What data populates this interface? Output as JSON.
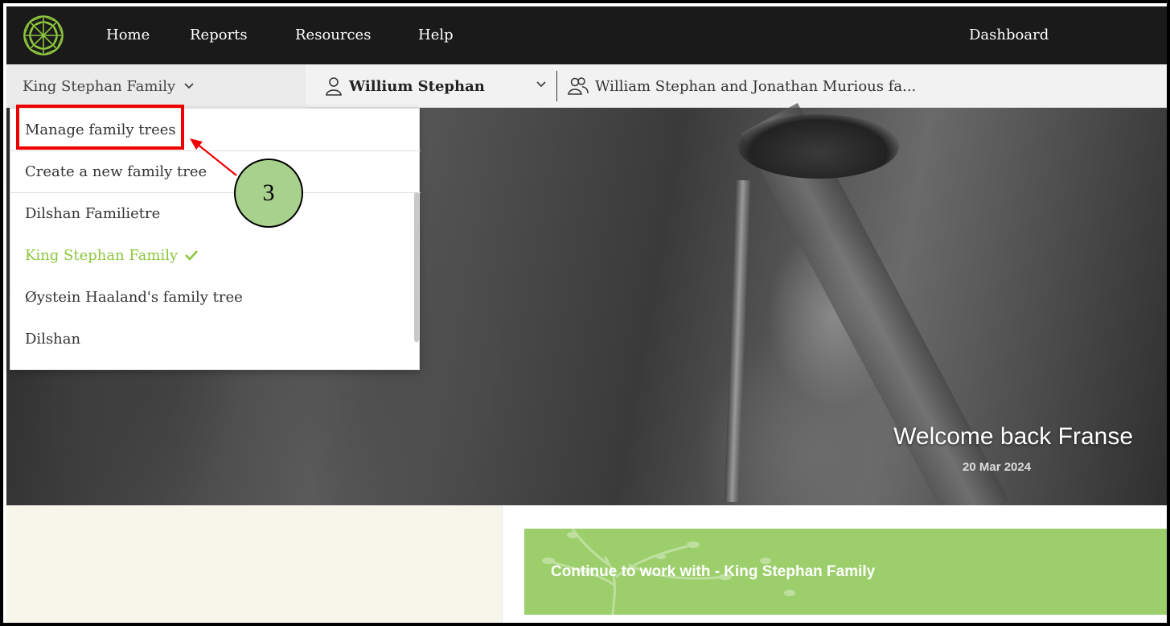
{
  "nav": {
    "home": "Home",
    "reports": "Reports",
    "resources": "Resources",
    "help": "Help",
    "dashboard": "Dashboard"
  },
  "subbar": {
    "tree_selected": "King Stephan Family",
    "person_name": "Willium Stephan",
    "family_name": "William Stephan and Jonathan Murious fa..."
  },
  "dropdown": {
    "actions": [
      "Manage family trees",
      "Create a new family tree"
    ],
    "trees": [
      {
        "label": "Dilshan Familietre",
        "active": false
      },
      {
        "label": "King Stephan Family",
        "active": true
      },
      {
        "label": "Øystein Haaland's family tree",
        "active": false
      },
      {
        "label": "Dilshan",
        "active": false
      }
    ]
  },
  "annotation": {
    "step": "3",
    "highlight_color": "#e00000",
    "callout_color": "#a8d18d"
  },
  "hero": {
    "welcome": "Welcome back Franse",
    "date": "20 Mar 2024"
  },
  "continue_card": {
    "label": "Continue to work with - King Stephan Family",
    "color": "#9ccf6b"
  },
  "colors": {
    "accent": "#8dc63f",
    "nav_bg": "#1a1a1a"
  },
  "icons": {
    "logo": "geometric-circle-logo",
    "person": "user-icon",
    "family": "users-icon",
    "chevron": "chevron-down-icon",
    "check": "check-icon"
  }
}
